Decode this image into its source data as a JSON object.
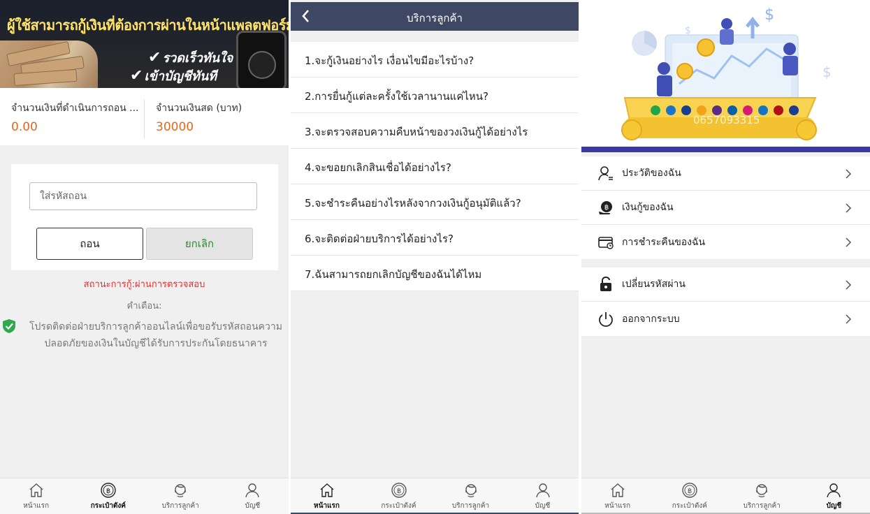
{
  "panel_withdraw": {
    "banner": {
      "title": "ผู้ใช้สามารถกู้เงินที่ต้องการผ่านในหน้าแพลตฟอร์ม",
      "line1": "รวดเร็วทันใจ",
      "line2": "เข้าบัญชีทันที"
    },
    "balances": [
      {
        "label": "จำนวนเงินที่ดำเนินการถอน ...",
        "value": "0.00"
      },
      {
        "label": "จำนวนเงินสด (บาท)",
        "value": "30000"
      }
    ],
    "form": {
      "password_placeholder": "ใส่รหัสถอน",
      "withdraw_label": "ถอน",
      "cancel_label": "ยกเลิก"
    },
    "status": "สถานะการกู้:ผ่านการตรวจสอบ",
    "warning_title": "คำเตือน:",
    "warning_text": "โปรดติดต่อฝ่ายบริการลูกค้าออนไลน์เพื่อขอรับรหัสถอนความปลอดภัยของเงินในบัญชีได้รับการประกันโดยธนาคาร",
    "active_tab": 1
  },
  "panel_service": {
    "title": "บริการลูกค้า",
    "faq": [
      "1.จะกู้เงินอย่างไร เงื่อนไขมีอะไรบ้าง?",
      "2.การยื่นกู้แต่ละครั้งใช้เวลานานแค่ไหน?",
      "3.จะตรวจสอบความคืบหน้าของวงเงินกู้ได้อย่างไร",
      "4.จะขอยกเลิกสินเชื่อได้อย่างไร?",
      "5.จะชำระคืนอย่างไรหลังจากวงเงินกู้อนุมัติแล้ว?",
      "6.จะติดต่อฝ่ายบริการได้อย่างไร?",
      "7.ฉันสามารถยกเลิกบัญชีของฉันได้ไหม"
    ],
    "active_tab": 0
  },
  "panel_account": {
    "watermark": "0657093315",
    "menu_group1": [
      {
        "label": "ประวัติของฉัน",
        "icon": "profile-history-icon"
      },
      {
        "label": "เงินกู้ของฉัน",
        "icon": "loan-coin-icon"
      },
      {
        "label": "การชำระคืนของฉัน",
        "icon": "card-repay-icon"
      }
    ],
    "menu_group2": [
      {
        "label": "เปลี่ยนรหัสผ่าน",
        "icon": "lock-icon"
      },
      {
        "label": "ออกจากระบบ",
        "icon": "power-icon"
      }
    ],
    "active_tab": 3
  },
  "tabs": [
    {
      "label": "หน้าแรก",
      "icon": "home-icon"
    },
    {
      "label": "กระเป๋าตังค์",
      "icon": "wallet-coin-icon"
    },
    {
      "label": "บริการลูกค้า",
      "icon": "headset-icon"
    },
    {
      "label": "บัญชี",
      "icon": "user-icon"
    }
  ],
  "colors": {
    "header": "#3e4863",
    "accent_orange": "#e8661e",
    "status_red": "#e03131",
    "cancel_green": "#2e8b2e",
    "hero_bar": "#3b3a9c"
  }
}
